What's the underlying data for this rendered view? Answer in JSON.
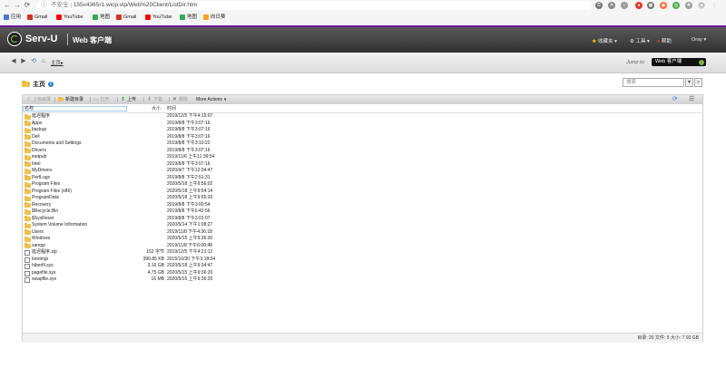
{
  "browser": {
    "insecure_label": "不安全",
    "url": "155v4365r1.wicp.vip/Web%20Client/ListDir.htm",
    "bookmarks": [
      {
        "label": "应用",
        "color": "#4a78d6"
      },
      {
        "label": "Gmail",
        "color": "#d93025"
      },
      {
        "label": "YouTube",
        "color": "#ff0000"
      },
      {
        "label": "地图",
        "color": "#34a853"
      },
      {
        "label": "Gmail",
        "color": "#d93025"
      },
      {
        "label": "YouTube",
        "color": "#ff0000"
      },
      {
        "label": "地图",
        "color": "#34a853"
      },
      {
        "label": "向日葵",
        "color": "#f6a21d"
      }
    ]
  },
  "header": {
    "brand": "Serv-U",
    "subtitle": "Web 客户端",
    "menu": {
      "favorites": "收藏夹",
      "tools": "工具",
      "help": "帮助",
      "user": "Oray"
    }
  },
  "crumb": {
    "home": "主页",
    "jump_to_label": "Jump to:",
    "jump_to_value": "Web 客户端"
  },
  "main": {
    "title": "主页",
    "search_placeholder": "搜索"
  },
  "toolbar": {
    "up_dir": "上级目录",
    "new_dir": "新建目录",
    "open": "打开",
    "upload": "上传",
    "download": "下载",
    "delete": "删除",
    "more": "More Actions"
  },
  "columns": {
    "name": "名称",
    "size": "大小",
    "time": "时间"
  },
  "files": [
    {
      "type": "folder",
      "name": "延迟程序",
      "size": "",
      "time": "2019/12/5 下午4:15:07"
    },
    {
      "type": "folder",
      "name": "Apps",
      "size": "",
      "time": "2019/8/8 下午3:07:16"
    },
    {
      "type": "folder",
      "name": "backup",
      "size": "",
      "time": "2019/8/8 下午3:07:16"
    },
    {
      "type": "folder",
      "name": "Dell",
      "size": "",
      "time": "2019/8/8 下午3:07:16"
    },
    {
      "type": "folder",
      "name": "Documents and Settings",
      "size": "",
      "time": "2019/8/8 下午3:10:22"
    },
    {
      "type": "folder",
      "name": "Drivers",
      "size": "",
      "time": "2019/8/8 下午3:07:16"
    },
    {
      "type": "folder",
      "name": "inetpub",
      "size": "",
      "time": "2019/11/6 上午11:39:54"
    },
    {
      "type": "folder",
      "name": "Intel",
      "size": "",
      "time": "2019/8/8 下午3:07:16"
    },
    {
      "type": "folder",
      "name": "MyDrivers",
      "size": "",
      "time": "2020/4/7 下午12:04:47"
    },
    {
      "type": "folder",
      "name": "PerfLogs",
      "size": "",
      "time": "2019/8/8 下午2:51:31"
    },
    {
      "type": "folder",
      "name": "Program Files",
      "size": "",
      "time": "2020/5/18 上午9:56:02"
    },
    {
      "type": "folder",
      "name": "Program Files (x86)",
      "size": "",
      "time": "2020/5/18 上午9:54:14"
    },
    {
      "type": "folder",
      "name": "ProgramData",
      "size": "",
      "time": "2020/5/18 上午9:55:20"
    },
    {
      "type": "folder",
      "name": "Recovery",
      "size": "",
      "time": "2019/8/8 下午3:00:54"
    },
    {
      "type": "folder",
      "name": "$Recycle.Bin",
      "size": "",
      "time": "2019/8/8 下午6:42:56"
    },
    {
      "type": "folder",
      "name": "$SysReset",
      "size": "",
      "time": "2019/8/8 下午3:01:07"
    },
    {
      "type": "folder",
      "name": "System Volume Information",
      "size": "",
      "time": "2020/5/14 下午1:08:27"
    },
    {
      "type": "folder",
      "name": "Users",
      "size": "",
      "time": "2019/11/8 下午4:36:18"
    },
    {
      "type": "folder",
      "name": "Windows",
      "size": "",
      "time": "2020/5/15 上午9:36:30"
    },
    {
      "type": "folder",
      "name": "xampp",
      "size": "",
      "time": "2019/11/8 下午6:00:48"
    },
    {
      "type": "file",
      "name": "延迟程序.zip",
      "size": "152 字节",
      "time": "2019/12/5 下午4:21:12"
    },
    {
      "type": "file",
      "name": "bootmgr",
      "size": "390.85 KB",
      "time": "2015/10/30 下午3:18:34"
    },
    {
      "type": "file",
      "name": "hiberfil.sys",
      "size": "3.16 GB",
      "time": "2020/5/18 上午9:34:47"
    },
    {
      "type": "file",
      "name": "pagefile.sys",
      "size": "4.75 GB",
      "time": "2020/5/15 上午9:36:20"
    },
    {
      "type": "file",
      "name": "swapfile.sys",
      "size": "16 MB",
      "time": "2020/5/15 上午9:36:20"
    }
  ],
  "status": {
    "text": "目录: 20   文件: 5   大小: 7.93 GB"
  }
}
